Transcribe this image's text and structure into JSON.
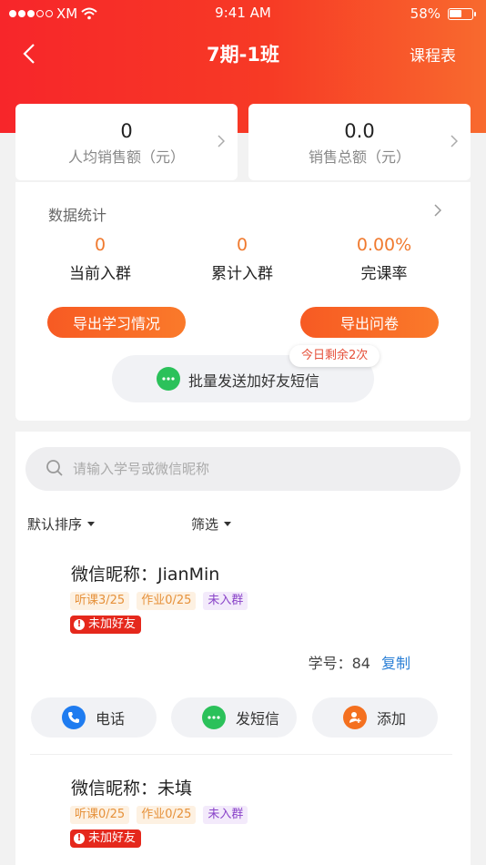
{
  "status_bar": {
    "carrier": "XM",
    "time": "9:41 AM",
    "battery": "58%",
    "battery_level": 0.58
  },
  "nav": {
    "title": "7期-1班",
    "right_label": "课程表"
  },
  "summary": [
    {
      "value": "0",
      "label": "人均销售额（元）"
    },
    {
      "value": "0.0",
      "label": "销售总额（元）"
    }
  ],
  "stats": {
    "title": "数据统计",
    "metrics": [
      {
        "value": "0",
        "label": "当前入群"
      },
      {
        "value": "0",
        "label": "累计入群"
      },
      {
        "value": "0.00%",
        "label": "完课率"
      }
    ],
    "export_study": "导出学习情况",
    "export_survey": "导出问卷",
    "sms_batch": "批量发送加好友短信",
    "sms_remaining": "今日剩余2次"
  },
  "search": {
    "placeholder": "请输入学号或微信昵称",
    "value": ""
  },
  "filters": {
    "sort": "默认排序",
    "filter": "筛选"
  },
  "students": [
    {
      "name": "微信昵称：JianMin",
      "tags": [
        "听课3/25",
        "作业0/25",
        "未入群"
      ],
      "friend_status": "未加好友",
      "student_id": "学号：84",
      "copy": "复制",
      "actions": [
        "电话",
        "发短信",
        "添加"
      ]
    },
    {
      "name": "微信昵称：未填",
      "tags": [
        "听课0/25",
        "作业0/25",
        "未入群"
      ],
      "friend_status": "未加好友"
    }
  ],
  "colors": {
    "header_start": "#f7262a",
    "header_end": "#f86a2e",
    "accent": "#f07a2f",
    "link": "#2a7fd6",
    "wechat_green": "#2bc15a",
    "phone_blue": "#1f7cf0",
    "warning_red": "#e5281c"
  }
}
